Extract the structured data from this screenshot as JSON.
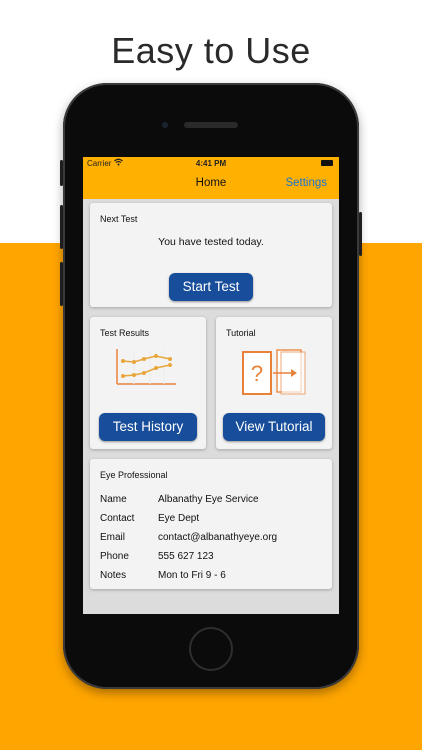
{
  "headline": "Easy to Use",
  "status_bar": {
    "carrier": "Carrier",
    "time": "4:41 PM"
  },
  "nav": {
    "title": "Home",
    "settings": "Settings"
  },
  "next_test": {
    "title": "Next Test",
    "message": "You have tested today.",
    "button": "Start Test"
  },
  "test_results": {
    "title": "Test Results",
    "button": "Test History"
  },
  "tutorial": {
    "title": "Tutorial",
    "button": "View Tutorial"
  },
  "eye_professional": {
    "title": "Eye Professional",
    "rows": [
      {
        "label": "Name",
        "value": "Albanathy Eye Service"
      },
      {
        "label": "Contact",
        "value": "Eye Dept"
      },
      {
        "label": "Email",
        "value": "contact@albanathyeye.org"
      },
      {
        "label": "Phone",
        "value": "555 627 123"
      },
      {
        "label": "Notes",
        "value": "Mon to Fri 9 - 6"
      }
    ]
  },
  "colors": {
    "accent_orange": "#ffa500",
    "nav_orange": "#ffb000",
    "button_blue": "#174d9a",
    "link_blue": "#1b75d6",
    "icon_orange": "#e8823a"
  },
  "icons": [
    "wifi-icon",
    "battery-icon",
    "line-chart-icon",
    "tutorial-icon"
  ]
}
